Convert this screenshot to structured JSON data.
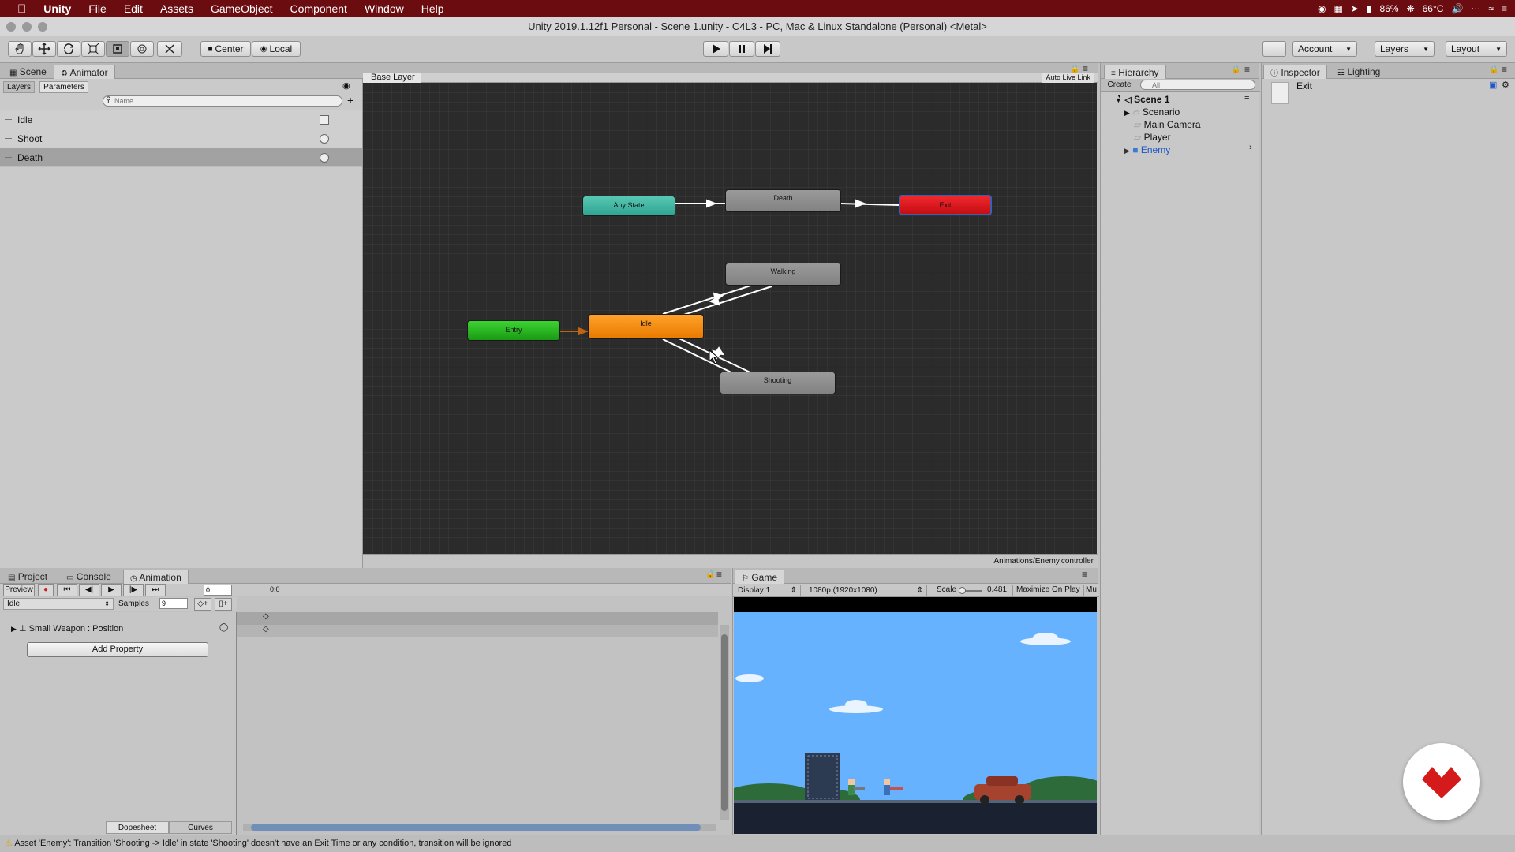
{
  "menubar": {
    "app": "Unity",
    "items": [
      "File",
      "Edit",
      "Assets",
      "GameObject",
      "Component",
      "Window",
      "Help"
    ],
    "status": {
      "battery": "86%",
      "temperature": "66°C"
    }
  },
  "window": {
    "title": "Unity 2019.1.12f1 Personal - Scene 1.unity - C4L3 - PC, Mac & Linux Standalone (Personal) <Metal>"
  },
  "toolbar": {
    "pivot_label": "Center",
    "space_label": "Local",
    "account_label": "Account",
    "layers_label": "Layers",
    "layout_label": "Layout"
  },
  "scene_tabs": {
    "scene": "Scene",
    "animator": "Animator"
  },
  "animator": {
    "subtabs": {
      "layers": "Layers",
      "parameters": "Parameters"
    },
    "search_placeholder": "Name",
    "parameters": [
      {
        "name": "Idle",
        "type": "bool"
      },
      {
        "name": "Shoot",
        "type": "trigger"
      },
      {
        "name": "Death",
        "type": "trigger"
      }
    ],
    "breadcrumb": "Base Layer",
    "auto_live_link": "Auto Live Link",
    "controller_path": "Animations/Enemy.controller",
    "states": {
      "any_state": "Any State",
      "death": "Death",
      "exit": "Exit",
      "walking": "Walking",
      "entry": "Entry",
      "idle": "Idle",
      "shooting": "Shooting"
    },
    "colors": {
      "any_state": "#3fae9c",
      "exit": "#d8121b",
      "entry": "#22b41c",
      "idle": "#f08a0e"
    }
  },
  "hierarchy": {
    "tab": "Hierarchy",
    "create_label": "Create",
    "search_placeholder": "All",
    "scene_name": "Scene 1",
    "items": [
      "Scenario",
      "Main Camera",
      "Player",
      "Enemy"
    ]
  },
  "inspector": {
    "tab": "Inspector",
    "lighting_tab": "Lighting",
    "object_name": "Exit"
  },
  "bottom_tabs": {
    "project": "Project",
    "console": "Console",
    "animation": "Animation"
  },
  "animation": {
    "preview_label": "Preview",
    "frame_value": "0",
    "time_label": "0:0",
    "clip": "Idle",
    "samples_label": "Samples",
    "samples_value": "9",
    "property": "Small Weapon : Position",
    "add_property": "Add Property",
    "dopesheet": "Dopesheet",
    "curves": "Curves"
  },
  "game": {
    "tab": "Game",
    "display": "Display 1",
    "resolution": "1080p (1920x1080)",
    "scale_label": "Scale",
    "scale_value": "0.481",
    "maximize": "Maximize On Play",
    "mute": "Mu"
  },
  "status_message": "Asset 'Enemy': Transition 'Shooting -> Idle' in state 'Shooting' doesn't have an Exit Time or any condition, transition will be ignored"
}
